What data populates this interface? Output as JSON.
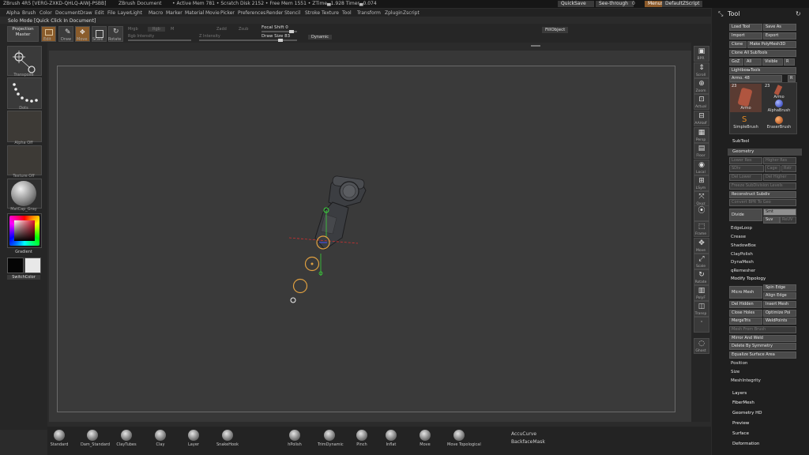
{
  "titlebar": {
    "app": "ZBrush 4R5 [VERG-ZXKD-QHLQ-AIWJ-PSBB]",
    "doc": "ZBrush Document",
    "stats": "• Active Mem 781 • Scratch Disk 2152 • Free Mem 1551 • ZTime▄1.928 Timer▄0.074",
    "quicksave": "QuickSave",
    "seethrough": "See-through",
    "seethrough_val": "0",
    "menus": "Menus",
    "zscript": "DefaultZScript"
  },
  "menubar": [
    "Alpha",
    "Brush",
    "Color",
    "Document",
    "Draw",
    "Edit",
    "File",
    "Layer",
    "Light",
    "Macro",
    "Marker",
    "Material",
    "Movie",
    "Picker",
    "Preferences",
    "Render",
    "Stencil",
    "Stroke",
    "Texture",
    "Tool",
    "Transform",
    "Zplugin",
    "Zscript"
  ],
  "solo": "Solo Mode [Quick Click In Document]",
  "shelf": {
    "projection_master": "Projection\nMaster",
    "buttons": [
      "Edit",
      "Draw",
      "Move",
      "Scale",
      "Rotate"
    ],
    "mrgb": "Mrgb",
    "rgb": "Rgb",
    "m": "M",
    "rgb_intensity": "Rgb Intensity",
    "zadd": "Zadd",
    "zsub": "Zsub",
    "z_intensity": "Z Intensity",
    "focal_shift": "Focal Shift 0",
    "draw_size": "Draw Size 83",
    "dynamic": "Dynamic",
    "fillobject": "FillObject"
  },
  "lefttray": {
    "transpose": "Transpose",
    "dots": "Dots",
    "alpha_off": "Alpha Off",
    "texture_off": "Texture Off",
    "material": "MatCap_Gray",
    "gradient": "Gradient",
    "switchcolor": "SwitchColor"
  },
  "rightcol": [
    "BPR",
    "Scroll",
    "Zoom",
    "Actual",
    "AAHalf",
    "Persp",
    "Floor",
    "Local",
    "LSym",
    "Qxyz",
    "",
    "Frame",
    "Move",
    "Scale",
    "Rotate",
    "PolyF",
    "Transp",
    "",
    "Ghost"
  ],
  "palette": {
    "title": "Tool",
    "load_tool": "Load Tool",
    "save_as": "Save As",
    "import": "Import",
    "export": "Export",
    "clone": "Clone",
    "make_polymesh": "Make PolyMesh3D",
    "clone_all": "Clone All SubTools",
    "goz": "GoZ",
    "all": "All",
    "visible": "Visible",
    "r": "R",
    "lightbox_tools": "Lightbox▸Tools",
    "armo": "Armo. 48",
    "r2": "R",
    "thumbs": [
      {
        "num": "23",
        "label": "Armo"
      },
      {
        "num": "23",
        "label": "Armo"
      },
      {
        "num": "",
        "label": "AlphaBrush"
      },
      {
        "num": "",
        "label": "SimpleBrush"
      },
      {
        "num": "",
        "label": "EraserBrush"
      }
    ],
    "subtool": "SubTool",
    "geometry": "Geometry",
    "lower_res": "Lower Res",
    "higher_res": "Higher Res",
    "sdiv": "SDiv",
    "cage": "Cage",
    "rstr": "Rstr",
    "del_lower": "Del Lower",
    "del_higher": "Del Higher",
    "freeze": "Freeze SubDivision Levels",
    "reconstruct": "Reconstruct Subdiv",
    "convert": "Convert BPR To Geo",
    "divide": "Divide",
    "smt": "Smt",
    "suv": "Suv",
    "reuv": "ReUV",
    "items": [
      "EdgeLoop",
      "Crease",
      "ShadowBox",
      "ClayPolish",
      "DynaMesh",
      "qRemesher"
    ],
    "modify_topology": "Modify Topology",
    "micro_mesh": "Micro Mesh",
    "spin_edge": "Spin Edge",
    "align_edge": "Align Edge",
    "del_hidden": "Del Hidden",
    "insert_mesh": "Insert Mesh",
    "close_holes": "Close Holes",
    "optimize": "Optimize Poi",
    "mergetris": "MergeTris",
    "weldpoints": "WeldPoints",
    "mesh_from_brush": "Mesh From Brush",
    "mirror_weld": "Mirror And Weld",
    "delete_symmetry": "Delete By Symmetry",
    "equalize": "Equalize Surface Area",
    "position": "Position",
    "size": "Size",
    "meshintegrity": "MeshIntegrity",
    "layers": "Layers",
    "fibermesh": "FiberMesh",
    "geometry_hd": "Geometry HD",
    "preview": "Preview",
    "surface": "Surface",
    "deformation": "Deformation"
  },
  "brushes": [
    "Standard",
    "Dam_Standard",
    "ClayTubes",
    "Clay",
    "Layer",
    "SnakeHook",
    "hPolish",
    "TrimDynamic",
    "Pinch",
    "Inflat",
    "Move",
    "Move Topological"
  ],
  "bottom": {
    "accucurve": "AccuCurve",
    "backfacemask": "BackfaceMask"
  }
}
